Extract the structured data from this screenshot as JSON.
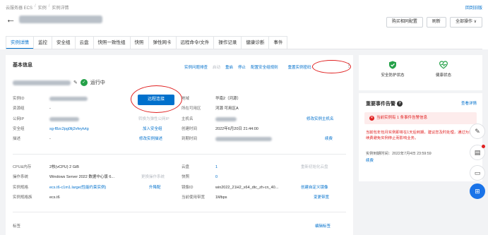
{
  "breadcrumb": [
    "云服务器 ECS",
    "实例",
    "实例详情"
  ],
  "back_link": "回到旧版",
  "header": {
    "buttons": [
      "购买相同配置",
      "刷新",
      "全部操作 ∨"
    ]
  },
  "tabs": [
    "实例详情",
    "监控",
    "安全组",
    "云盘",
    "快照一致性组",
    "快照",
    "弹性网卡",
    "远程命令/文件",
    "操作记录",
    "健康诊断",
    "事件"
  ],
  "basic": {
    "title": "基本信息",
    "actions": [
      "实例问题排查",
      "启动",
      "重启",
      "停止",
      "配置安全组规则",
      "重置实例密码"
    ],
    "status": "运行中",
    "remote_button": "远程连接",
    "left_rows": [
      {
        "label": "实例ID",
        "value": "",
        "type": "blur"
      },
      {
        "label": "资源组",
        "value": "-",
        "type": "text"
      },
      {
        "label": "公网IP",
        "value": "",
        "type": "blur",
        "extra": "转换为弹性公网IP"
      },
      {
        "label": "安全组",
        "value": "sg-f8zc2pg0lij2vfeytvtg",
        "type": "link",
        "extra": "加入安全组"
      },
      {
        "label": "描述",
        "value": "-",
        "type": "text",
        "extra": "修改实例描述"
      }
    ],
    "right_rows": [
      {
        "label": "地域",
        "value": "华南2（河源）",
        "type": "text"
      },
      {
        "label": "所在可用区",
        "value": "河源 可用区A",
        "type": "text"
      },
      {
        "label": "主机名",
        "value": "",
        "type": "blur",
        "extra": "修改实例主机名"
      },
      {
        "label": "创建时间",
        "value": "2022年6月20日 21:44:00",
        "type": "text"
      },
      {
        "label": "到期时间",
        "value": "",
        "type": "blur",
        "extra": "续费"
      }
    ]
  },
  "config": {
    "left_rows": [
      {
        "label": "CPU&内存",
        "value": "2核(vCPU) 2 GiB",
        "type": "text"
      },
      {
        "label": "操作系统",
        "value": "Windows Server 2022 数据中心版 6...",
        "type": "text",
        "extra": "更换操作系统"
      },
      {
        "label": "实例规格",
        "value": "ecs.t6-c1m1.large(性能约束实例)",
        "type": "link",
        "extra": "升降配"
      },
      {
        "label": "实例规格族",
        "value": "ecs.t6",
        "type": "text"
      }
    ],
    "right_rows": [
      {
        "label": "云盘",
        "value": "1",
        "type": "link",
        "extra": "重新初始化云盘"
      },
      {
        "label": "快照",
        "value": "0",
        "type": "link"
      },
      {
        "label": "镜像ID",
        "value": "win2022_21H2_x64_dtc_zh-cn_40...",
        "type": "text",
        "extra": "创建自定义镜像"
      },
      {
        "label": "当前使用带宽",
        "value": "1Mbps",
        "type": "text",
        "extra": "变更带宽"
      }
    ],
    "tag_label": "标签",
    "tag_link": "编辑标签"
  },
  "security": {
    "items": [
      "安全防护状态",
      "健康状态"
    ]
  },
  "events": {
    "title": "重要事件告警",
    "help": "?",
    "link": "查看详情",
    "alert": "当前实例有 1 条事件告警信息",
    "desc": "当前包年包月实例即将在1天后到期，建议您及时处理，通过为实例续费避免实例停止而影响业务。",
    "time_label": "实例到期时间：2022年7月4日 23:59:59",
    "continue": "续费"
  },
  "colors": {
    "accent": "#0070cc",
    "running": "#24a148",
    "alert": "#e02020"
  }
}
